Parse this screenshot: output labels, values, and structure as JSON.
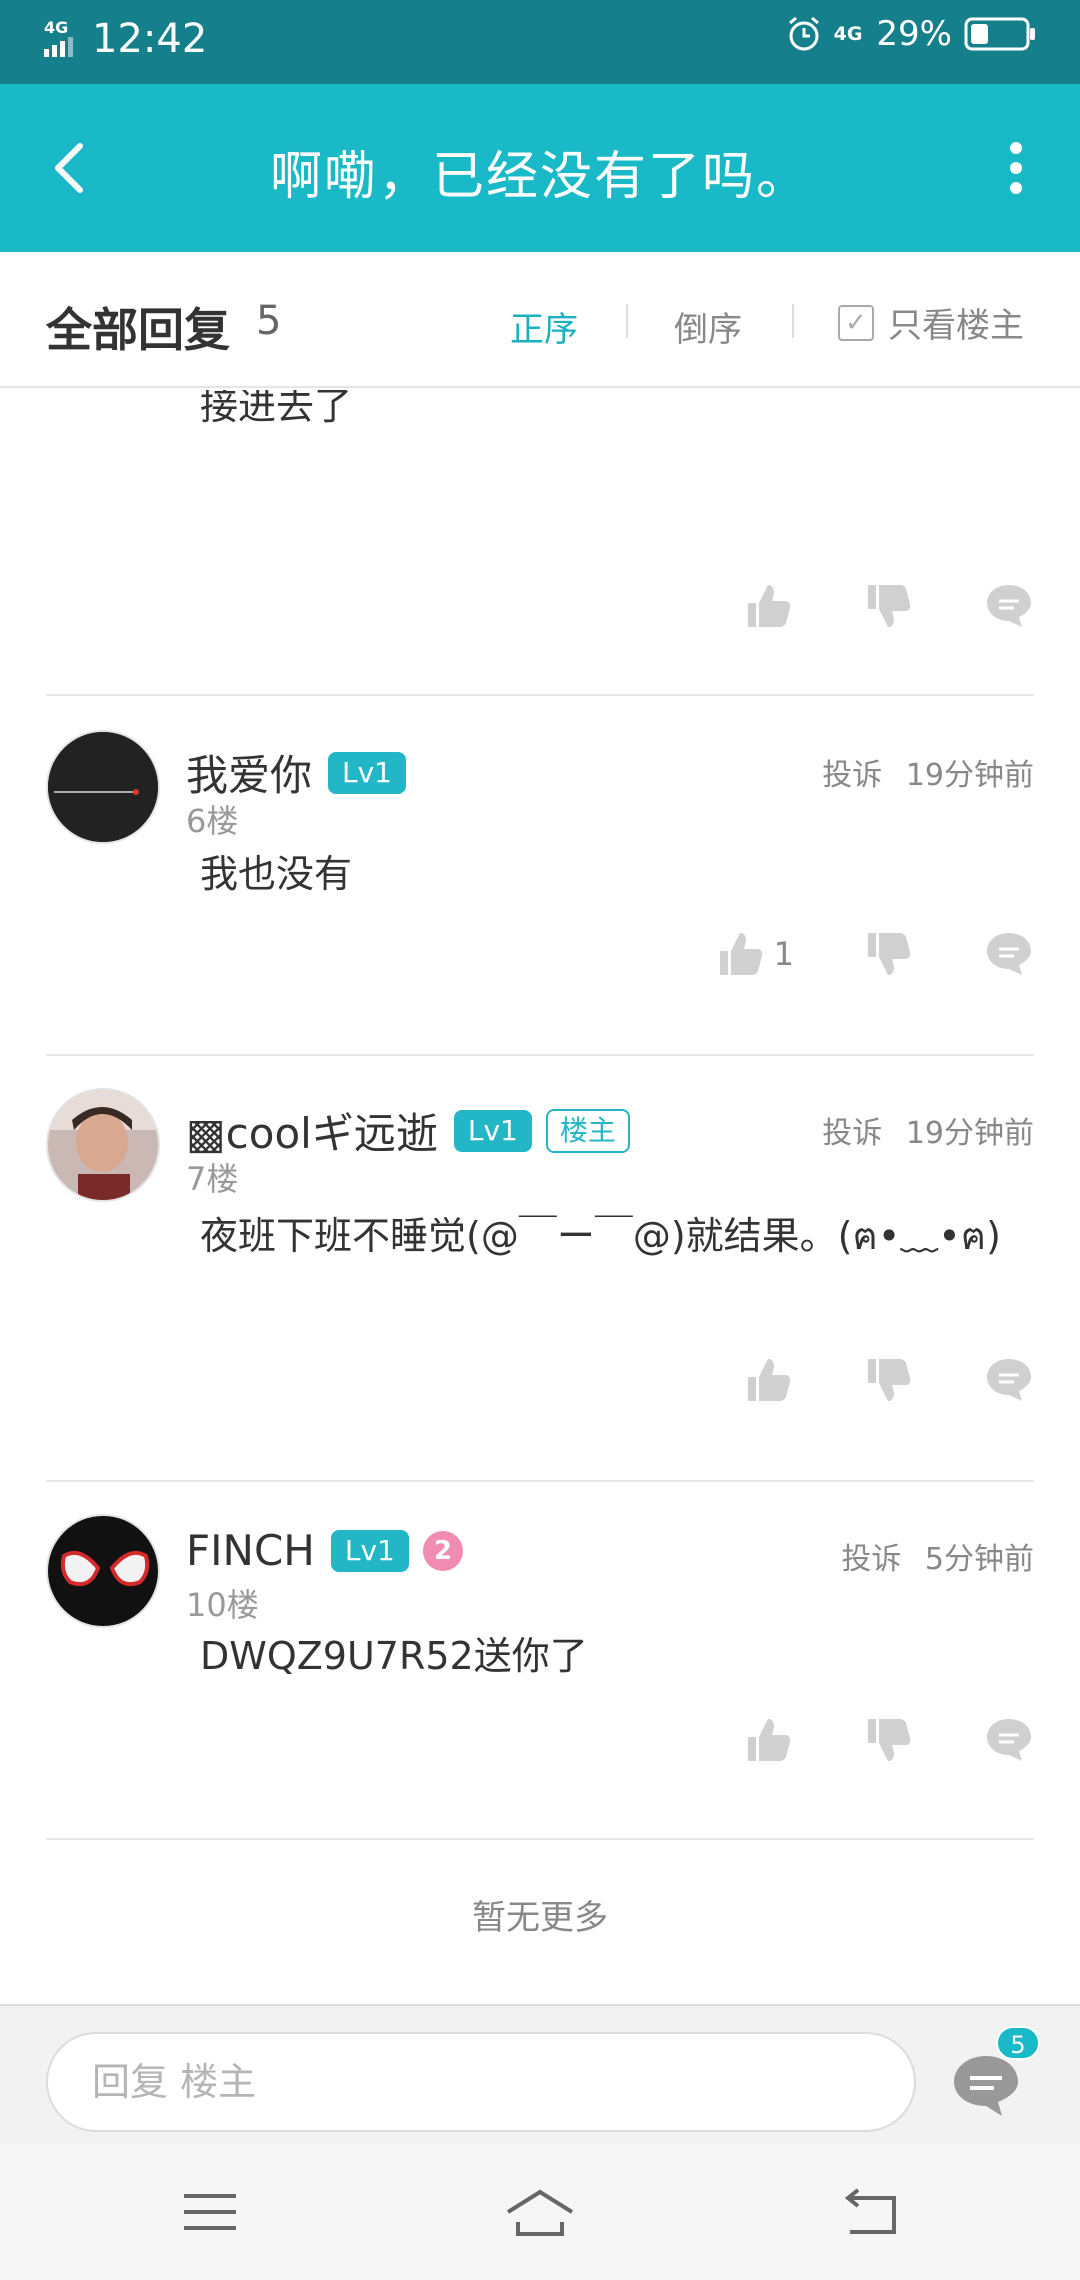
{
  "status_bar": {
    "network": "4G",
    "time": "12:42",
    "network_right": "4G",
    "battery": "29%"
  },
  "app_bar": {
    "title": "啊嘞，已经没有了吗。"
  },
  "subheader": {
    "title": "全部回复",
    "count": "5",
    "sort_asc": "正序",
    "sort_desc": "倒序",
    "only_op": "只看楼主"
  },
  "posts": [
    {
      "body": "接进去了"
    },
    {
      "username": "我爱你",
      "level": "Lv1",
      "report": "投诉",
      "time": "19分钟前",
      "floor": "6楼",
      "body": "我也没有",
      "likes": "1"
    },
    {
      "username": "▩coolギ远逝",
      "level": "Lv1",
      "host_tag": "楼主",
      "report": "投诉",
      "time": "19分钟前",
      "floor": "7楼",
      "body": "夜班下班不睡觉(@￣ー￣@)就结果。(ฅ•﹏•ฅ)"
    },
    {
      "username": "FINCH",
      "level": "Lv1",
      "medal": "2",
      "report": "投诉",
      "time": "5分钟前",
      "floor": "10楼",
      "body": "DWQZ9U7R52送你了"
    }
  ],
  "footer": {
    "no_more": "暂无更多"
  },
  "reply_bar": {
    "placeholder": "回复  楼主",
    "badge": "5"
  },
  "colors": {
    "status_bar": "#157f8c",
    "app_bar": "#19b9c7",
    "accent": "#19b0bf"
  },
  "icons": [
    "back-arrow-icon",
    "more-vertical-icon",
    "checkbox-icon",
    "thumb-up-icon",
    "thumb-down-icon",
    "comment-icon",
    "comments-icon",
    "menu-icon",
    "home-icon",
    "back-nav-icon"
  ]
}
